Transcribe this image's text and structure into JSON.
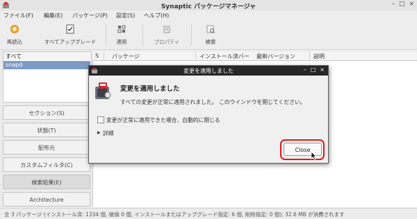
{
  "window": {
    "title": "Synaptic パッケージマネージャ",
    "controls": [
      "–",
      "□",
      "×"
    ]
  },
  "menu": [
    "ファイル(F)",
    "編集(E)",
    "パッケージ(P)",
    "設定(S)",
    "ヘルプ(H)"
  ],
  "toolbar": {
    "reload": "再読込",
    "mark_all_upgrades": "すべてアップグレード",
    "apply": "適用",
    "properties": "プロパティ",
    "search": "検索"
  },
  "filter": {
    "header": "すべて",
    "selected": "snapd"
  },
  "left_buttons": [
    "セクション(S)",
    "状態(T)",
    "配布元",
    "カスタムフィルタ(C)",
    "検索結果(E)",
    "Architecture"
  ],
  "columns": {
    "s": "S",
    "package": "パッケージ",
    "installed": "インストール済バー",
    "latest": "最新バージョン",
    "description": "説明"
  },
  "status": "全 3 パッケージ (インストール済: 1334 個, 破損 0 個, インストールまたはアップグレード指定: 6 個, 削除指定: 0 個); 32.6 MB が消費されます",
  "dialog": {
    "title": "変更を適用しました",
    "controls": [
      "–",
      "□",
      "×"
    ],
    "heading": "変更を適用しました",
    "message": "すべての変更が正常に適用されました。 このウインドウを閉じてください。",
    "checkbox_label": "変更が正常に適用できた場合、自動的に閉じる",
    "checkbox_checked": false,
    "details": "詳細",
    "close": "Close"
  },
  "colors": {
    "selection": "#7e9bc4",
    "highlight_ring": "#e0151b",
    "dialog_titlebar": "#262626"
  }
}
